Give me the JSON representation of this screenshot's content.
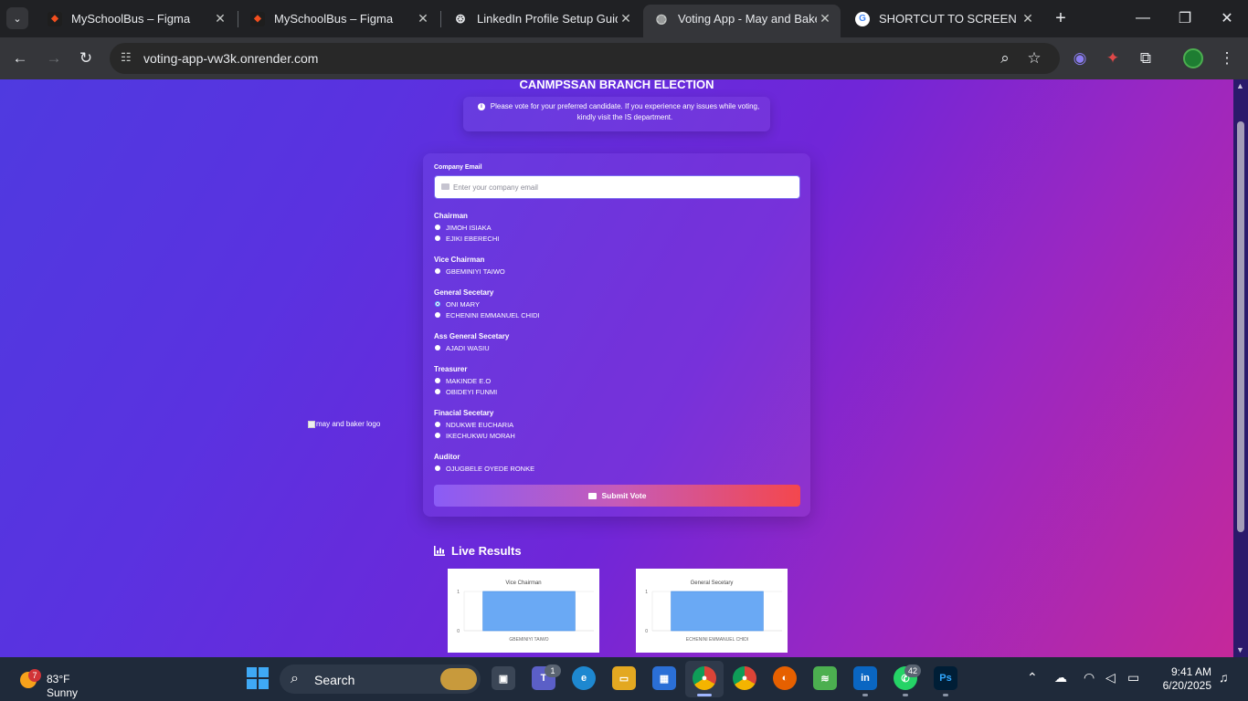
{
  "browser": {
    "tabs": [
      {
        "title": "MySchoolBus – Figma",
        "icon": "figma-icon"
      },
      {
        "title": "MySchoolBus – Figma",
        "icon": "figma-icon"
      },
      {
        "title": "LinkedIn Profile Setup Guide",
        "icon": "openai-icon"
      },
      {
        "title": "Voting App - May and Baker",
        "icon": "globe-icon",
        "active": true
      },
      {
        "title": "SHORTCUT TO SCREEN REC",
        "icon": "google-icon"
      }
    ],
    "url": "voting-app-vw3k.onrender.com"
  },
  "page": {
    "election_title": "CANMPSSAN BRANCH ELECTION",
    "notice": "Please vote for your preferred candidate. If you experience any issues while voting, kindly visit the IS department.",
    "logo_alt": "may and baker logo",
    "email_label": "Company Email",
    "email_placeholder": "Enter your company email",
    "email_value": "",
    "positions": [
      {
        "title": "Chairman",
        "candidates": [
          {
            "name": "JIMOH ISIAKA"
          },
          {
            "name": "EJIKI EBERECHI"
          }
        ]
      },
      {
        "title": "Vice Chairman",
        "candidates": [
          {
            "name": "GBEMINIYI TAIWO"
          }
        ]
      },
      {
        "title": "General Secetary",
        "candidates": [
          {
            "name": "ONI MARY",
            "selected": true
          },
          {
            "name": "ECHENINI EMMANUEL CHIDI"
          }
        ]
      },
      {
        "title": "Ass General Secetary",
        "candidates": [
          {
            "name": "AJADI WASIU"
          }
        ]
      },
      {
        "title": "Treasurer",
        "candidates": [
          {
            "name": "MAKINDE E.O"
          },
          {
            "name": "OBIDEYI FUNMI"
          }
        ]
      },
      {
        "title": "Finacial Secetary",
        "candidates": [
          {
            "name": "NDUKWE EUCHARIA"
          },
          {
            "name": "IKECHUKWU MORAH"
          }
        ]
      },
      {
        "title": "Auditor",
        "candidates": [
          {
            "name": "OJUGBELE OYEDE RONKE"
          }
        ]
      }
    ],
    "submit_label": "Submit Vote",
    "results_title": "Live Results"
  },
  "chart_data": [
    {
      "type": "bar",
      "title": "Vice Chairman",
      "categories": [
        "GBEMINIYI TAIWO"
      ],
      "values": [
        1
      ],
      "ylim": [
        0,
        1
      ],
      "yticks": [
        "1",
        "0"
      ],
      "color": "#6aa9f4"
    },
    {
      "type": "bar",
      "title": "General Secetary",
      "categories": [
        "ECHENINI EMMANUEL CHIDI"
      ],
      "values": [
        1
      ],
      "ylim": [
        0,
        1
      ],
      "yticks": [
        "1",
        "0"
      ],
      "color": "#6aa9f4"
    }
  ],
  "taskbar": {
    "weather_temp": "83°F",
    "weather_cond": "Sunny",
    "weather_badge": "7",
    "search_label": "Search",
    "teams_badge": "1",
    "whatsapp_badge": "42",
    "time": "9:41 AM",
    "date": "6/20/2025"
  }
}
